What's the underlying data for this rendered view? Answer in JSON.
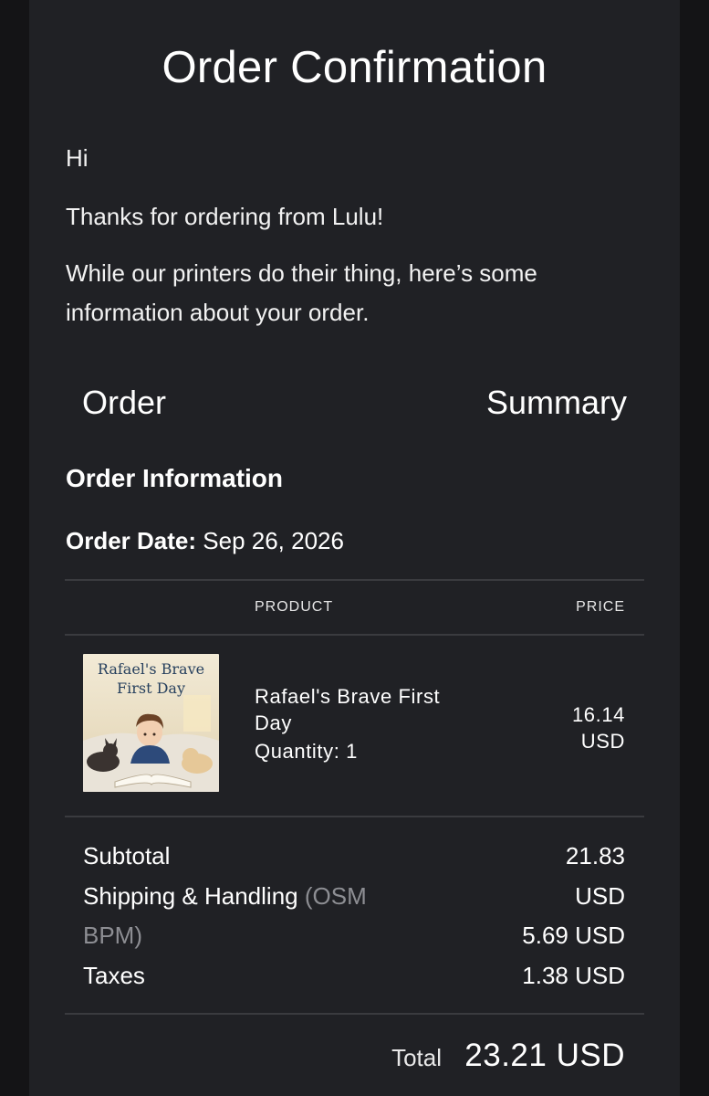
{
  "title": "Order Confirmation",
  "greeting": "Hi",
  "thanks": "Thanks for ordering from Lulu!",
  "info_text": "While our printers do their thing, here’s some information about your order.",
  "summary": {
    "left": "Order",
    "right": "Summary"
  },
  "order_info": {
    "heading": "Order Information",
    "date_label": "Order Date:",
    "date_value": "Sep 26, 2026"
  },
  "table": {
    "headers": {
      "product": "PRODUCT",
      "price": "PRICE"
    },
    "items": [
      {
        "cover_title": "Rafael's Brave First Day",
        "name": "Rafael's Brave First Day",
        "quantity_label": "Quantity:",
        "quantity": "1",
        "price": "16.14 USD"
      }
    ]
  },
  "totals": {
    "subtotal_label": "Subtotal",
    "subtotal_value": "21.83 USD",
    "shipping_label": "Shipping & Handling",
    "shipping_method": "(OSM BPM)",
    "shipping_value": "5.69 USD",
    "taxes_label": "Taxes",
    "taxes_value": "1.38 USD",
    "total_label": "Total",
    "total_value": "23.21 USD"
  },
  "colors": {
    "page_bg": "#141416",
    "card_bg": "#202125",
    "text": "#ffffff",
    "muted": "#8d8e93",
    "divider": "#3a3b3f"
  }
}
